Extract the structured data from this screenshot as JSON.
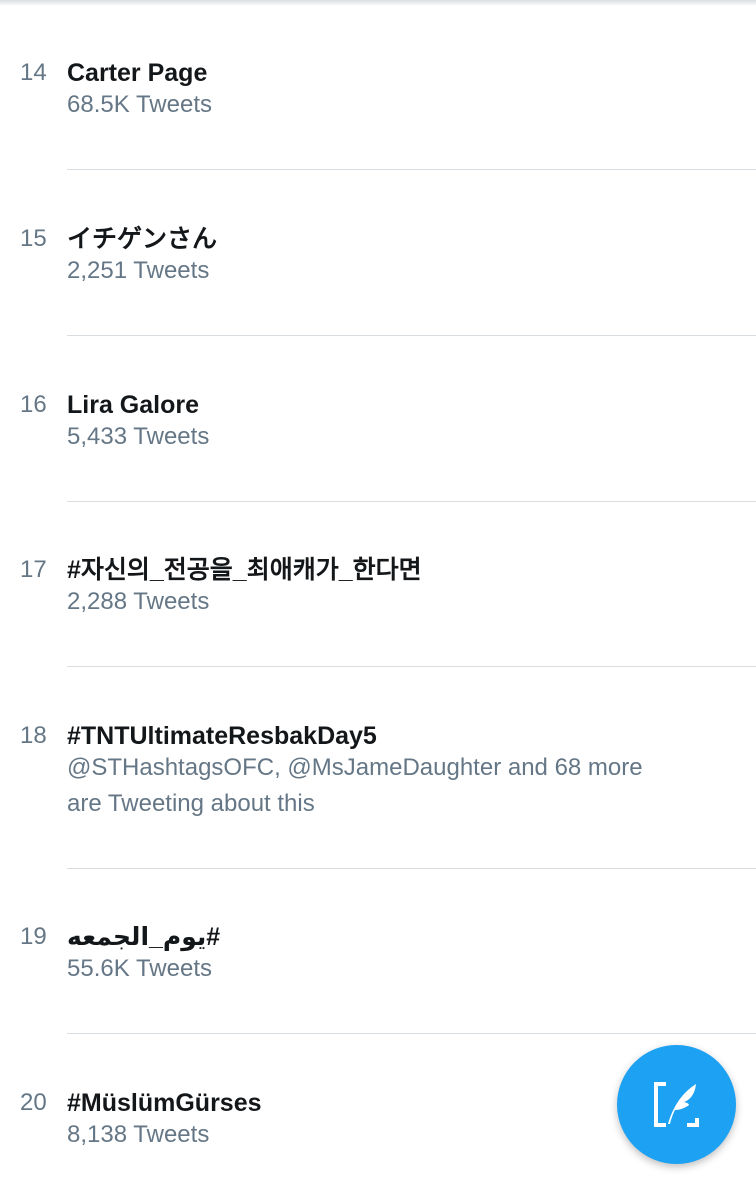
{
  "trends": [
    {
      "rank": "14",
      "name": "Carter Page",
      "meta": "68.5K Tweets"
    },
    {
      "rank": "15",
      "name": "イチゲンさん",
      "meta": "2,251 Tweets"
    },
    {
      "rank": "16",
      "name": "Lira Galore",
      "meta": "5,433 Tweets"
    },
    {
      "rank": "17",
      "name": "#자신의_전공을_최애캐가_한다면",
      "meta": "2,288 Tweets"
    },
    {
      "rank": "18",
      "name": "#TNTUltimateResbakDay5",
      "meta": "@STHashtagsOFC, @MsJameDaughter and 68 more are Tweeting about this"
    },
    {
      "rank": "19",
      "name": "#يوم_الجمعه",
      "meta": "55.6K Tweets"
    },
    {
      "rank": "20",
      "name": "#MüslümGürses",
      "meta": "8,138 Tweets"
    }
  ],
  "compose_button": {
    "icon": "compose-tweet-icon",
    "color": "#1da1f2"
  }
}
